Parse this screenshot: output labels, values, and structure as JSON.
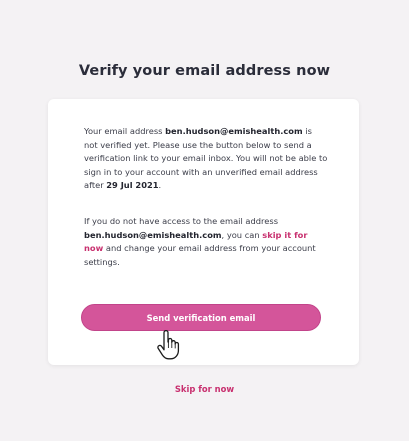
{
  "heading": "Verify your email address now",
  "message1": {
    "lead": "Your email address ",
    "email": "ben.hudson@emishealth.com",
    "middle": " is not verified yet. Please use the button below to send a verification link to your email inbox. You will not be able to sign in to your account with an unverified email address after ",
    "deadline": "29 Jul 2021",
    "end": "."
  },
  "message2": {
    "lead": "If you do not have access to the email address ",
    "email": "ben.hudson@emishealth.com",
    "middle": ", you can ",
    "link": "skip it for now",
    "end": " and change your email address from your account settings."
  },
  "buttons": {
    "send": "Send verification email",
    "skip": "Skip for now"
  },
  "icons": {
    "cursor": "hand-pointer-icon"
  },
  "colors": {
    "accent": "#d4559a",
    "link": "#c8306f",
    "background": "#f4f2f4"
  }
}
